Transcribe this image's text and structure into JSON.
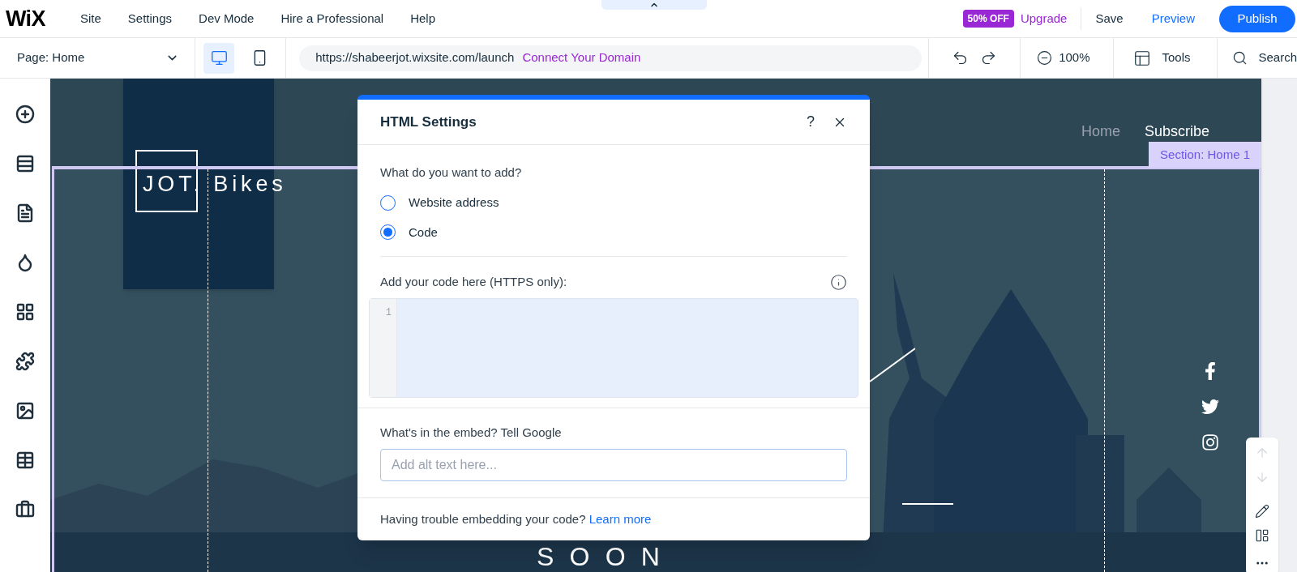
{
  "topbar": {
    "logo": "WiX",
    "menu": [
      "Site",
      "Settings",
      "Dev Mode",
      "Hire a Professional",
      "Help"
    ],
    "promo_badge": "50% OFF",
    "upgrade": "Upgrade",
    "save": "Save",
    "preview": "Preview",
    "publish": "Publish"
  },
  "toolbar": {
    "page_selector": "Page: Home",
    "devices": [
      {
        "kind": "desktop",
        "selected": true
      },
      {
        "kind": "mobile",
        "selected": false
      }
    ],
    "url": "https://shabeerjot.wixsite.com/launch",
    "connect_domain": "Connect Your Domain",
    "zoom": "100%",
    "tools": "Tools",
    "search": "Search"
  },
  "left_sidebar": [
    {
      "kind": "add"
    },
    {
      "kind": "sections"
    },
    {
      "kind": "pages"
    },
    {
      "kind": "design"
    },
    {
      "kind": "apps"
    },
    {
      "kind": "business"
    },
    {
      "kind": "media"
    },
    {
      "kind": "cms"
    },
    {
      "kind": "portfolio"
    }
  ],
  "site": {
    "logo": "JOT. Bikes",
    "nav": [
      {
        "label": "Home",
        "selected": false
      },
      {
        "label": "Subscribe",
        "selected": true
      }
    ],
    "section_label": "Section: Home 1",
    "heading": "SOON",
    "social": [
      {
        "kind": "facebook"
      },
      {
        "kind": "twitter"
      },
      {
        "kind": "instagram"
      }
    ]
  },
  "dialog": {
    "title": "HTML Settings",
    "help": "?",
    "question": "What do you want to add?",
    "options": [
      {
        "label": "Website address",
        "selected": false
      },
      {
        "label": "Code",
        "selected": true
      }
    ],
    "code_label": "Add your code here (HTTPS only):",
    "line_numbers": [
      "1"
    ],
    "embed_label": "What's in the embed? Tell Google",
    "alt_text": {
      "placeholder": "Add alt text here..."
    },
    "footer_text": "Having trouble embedding your code?",
    "footer_link": "Learn more"
  }
}
